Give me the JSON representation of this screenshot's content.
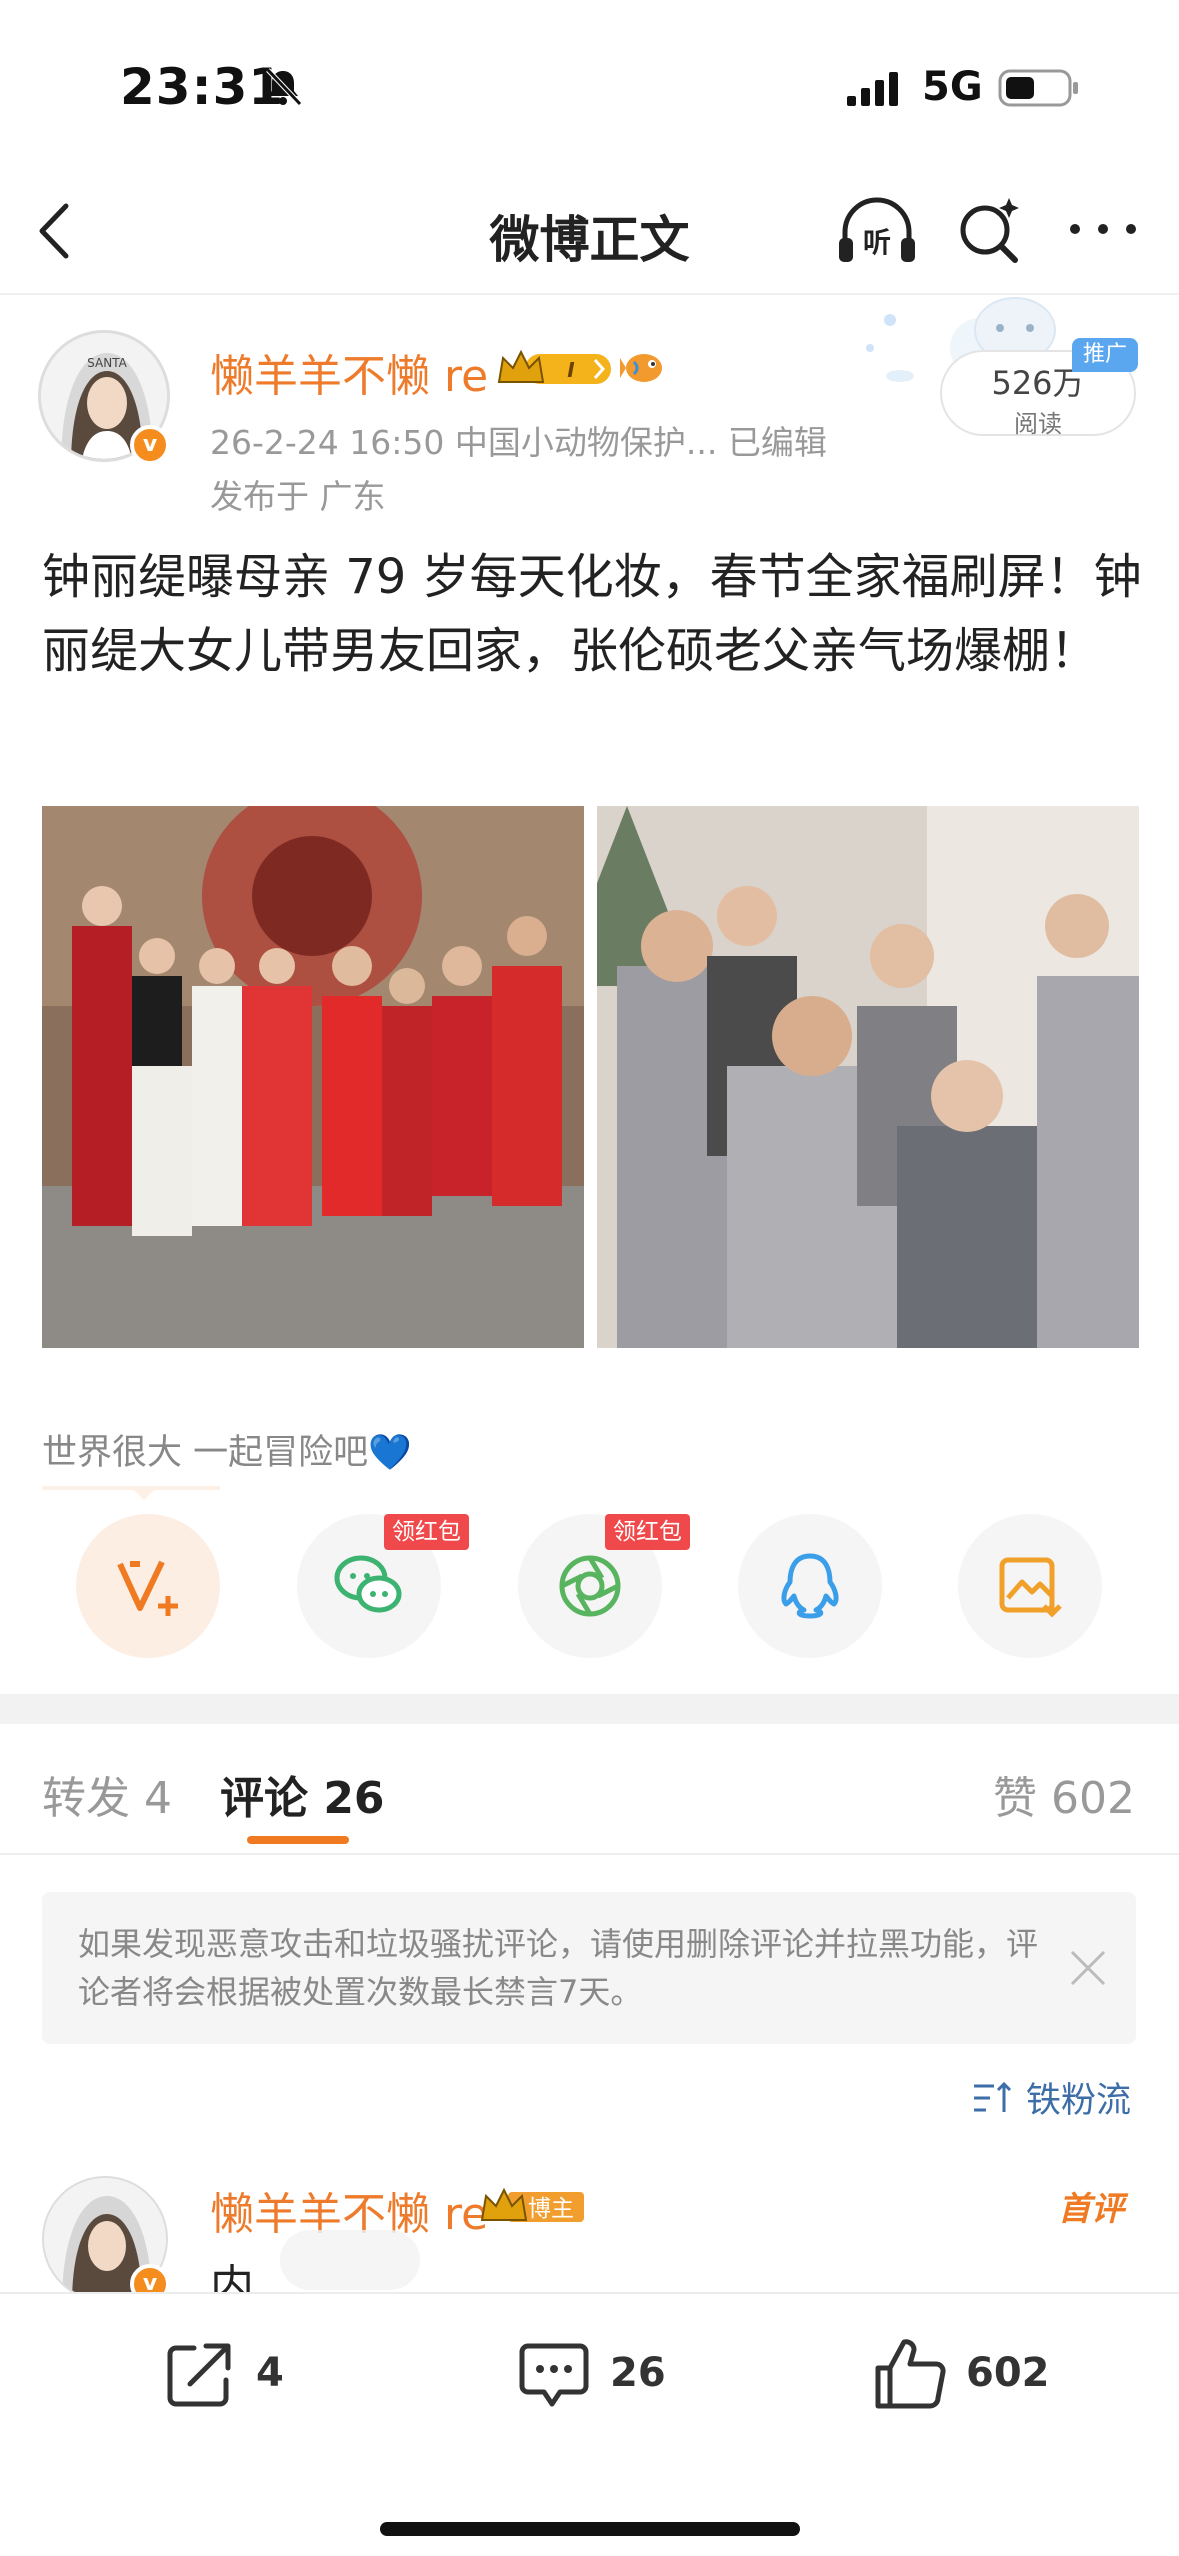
{
  "status_bar": {
    "time": "23:31",
    "network": "5G",
    "icons": [
      "bell-slash-icon",
      "signal-icon",
      "battery-icon"
    ]
  },
  "nav": {
    "title": "微博正文",
    "icons": [
      "back-icon",
      "listen-icon",
      "search-icon",
      "more-icon"
    ]
  },
  "post": {
    "author": "懒羊羊不懒 re",
    "meta": "26-2-24 16:50  中国小动物保护...  已编辑",
    "location": "发布于 广东",
    "read_count": "526万",
    "read_label": "阅读",
    "promo_tag": "推广",
    "text": "钟丽缇曝母亲 79 岁每天化妆，春节全家福刷屏！钟丽缇大女儿带男友回家，张伦硕老父亲气场爆棚！",
    "topic": "世界很大 一起冒险吧💙",
    "images": [
      "family-photo-red-outfits",
      "family-photo-sequin-outfits"
    ]
  },
  "share": {
    "buttons": [
      "v-plus-icon",
      "wechat-icon",
      "moments-icon",
      "qq-icon",
      "save-image-icon"
    ],
    "red_packet_label": "领红包"
  },
  "tabs": {
    "reposts": "转发 4",
    "comments": "评论 26",
    "likes": "赞 602"
  },
  "notice": {
    "text": "如果发现恶意攻击和垃圾骚扰评论，请使用删除评论并拉黑功能，评论者将会根据被处置次数最长禁言7天。"
  },
  "sort": {
    "label": "铁粉流"
  },
  "comment": {
    "author": "懒羊羊不懒 re",
    "role_badge": "博主",
    "first_tag": "首评",
    "text": "内"
  },
  "actions": {
    "repost_count": "4",
    "comment_count": "26",
    "like_count": "602"
  },
  "colors": {
    "accent_orange": "#f07a22",
    "username_orange": "#ee7b2b",
    "link_blue": "#3d6ea8",
    "red_packet": "#f0494b"
  }
}
